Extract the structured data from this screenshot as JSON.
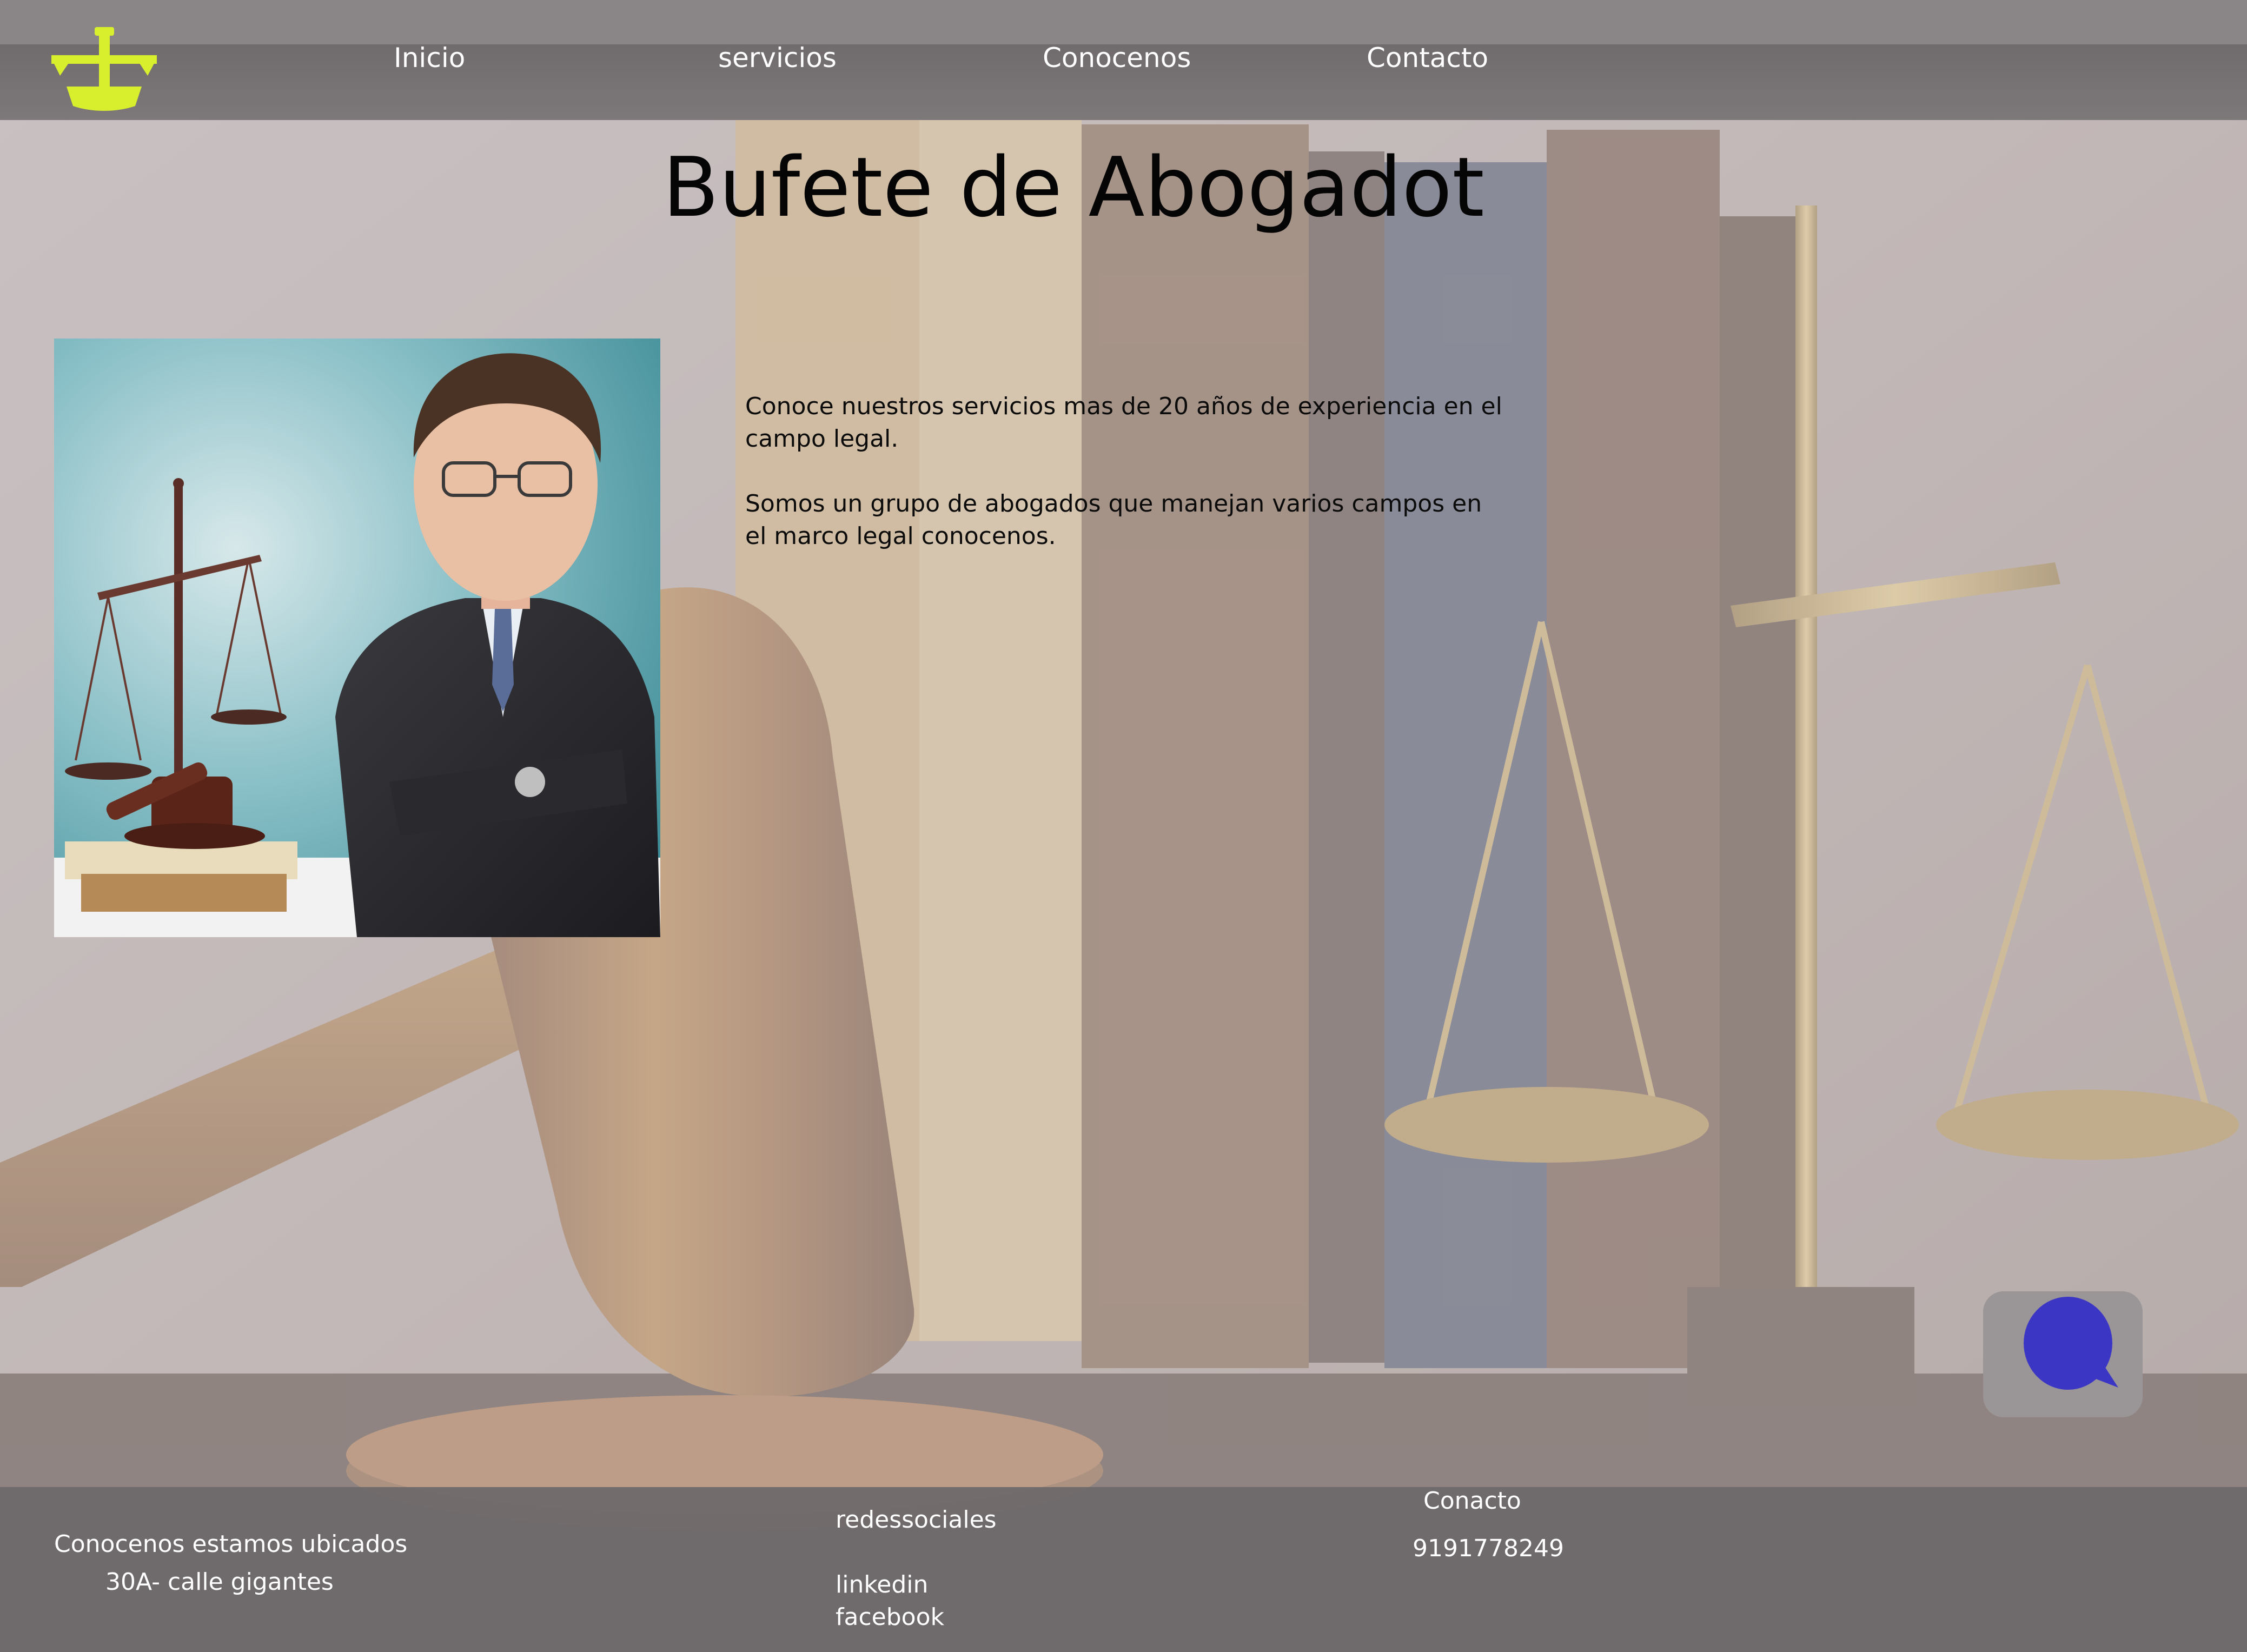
{
  "colors": {
    "nav_background": "#706b6c",
    "footer_background": "#6c686a",
    "logo_accent": "#d8ef2e",
    "chat_icon": "#3c36c4",
    "chat_button_bg": "#9a9697",
    "nav_text": "#ffffff"
  },
  "header": {
    "logo_icon": "scales-of-justice-icon",
    "nav": [
      {
        "label": "Inicio"
      },
      {
        "label": "servicios"
      },
      {
        "label": "Conocenos"
      },
      {
        "label": "Contacto"
      }
    ]
  },
  "main": {
    "title": "Bufete de Abogadot",
    "intro": [
      "Conoce nuestros servicios mas de 20 años de experiencia en el campo legal.",
      "Somos un grupo de abogados que manejan varios campos en el marco legal conocenos."
    ],
    "photo_icon": "lawyer-with-scales-photo",
    "chat_icon": "chat-bubble-icon"
  },
  "footer": {
    "about": "Conocenos  estamos ubicados",
    "address": "30A- calle gigantes",
    "social_title": "redessociales",
    "social_links": [
      "linkedin",
      "facebook"
    ],
    "contact_title": "Conacto",
    "phone": "9191778249"
  }
}
